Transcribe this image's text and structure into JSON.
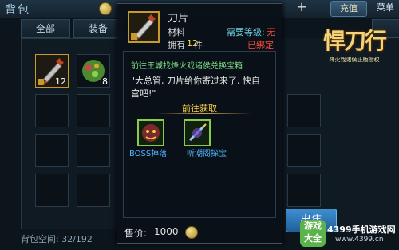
{
  "header": {
    "bag_title": "背包",
    "plus_label": "+",
    "recharge_label": "充值",
    "menu_label": "菜单"
  },
  "tabs": [
    {
      "label": "全部"
    },
    {
      "label": "装备"
    },
    {
      "label": ""
    }
  ],
  "bag": {
    "slots": [
      {
        "count": "12",
        "locked": true
      },
      {
        "count": "8",
        "locked": false
      }
    ],
    "space_label": "背包空间: 32/192"
  },
  "logo": {
    "title": "悍刀行",
    "subtitle": "烽火戏诸侯正版授权"
  },
  "sell_button": {
    "label": "出售"
  },
  "tooltip": {
    "item_name": "刀片",
    "item_type": "材料",
    "req_level_label": "需要等级:",
    "req_level_value": "无",
    "own_label": "拥有",
    "own_count": "12",
    "own_unit": "件",
    "bound_label": "已绑定",
    "quest_line": "前往王城找烽火戏诸侯兑换宝箱",
    "quote": "\"大总管, 刀片给你寄过来了, 快自宫吧!\"",
    "get_header": "前往获取",
    "sources": [
      {
        "label": "BOSS掉落",
        "icon": "boss-icon"
      },
      {
        "label": "听潮阁探宝",
        "icon": "treasure-icon"
      }
    ],
    "price_label": "售价:",
    "price_value": "1000"
  },
  "watermark": {
    "logo_text": "游戏大全",
    "line1": "4399手机游戏网",
    "line2": "www.4399.cn"
  },
  "colors": {
    "highlight_green": "#7fe08a",
    "link_blue": "#4eb5ff",
    "warning_red": "#ff4a3a",
    "level_cyan": "#6fd1e6",
    "gold": "#ffd54a"
  }
}
